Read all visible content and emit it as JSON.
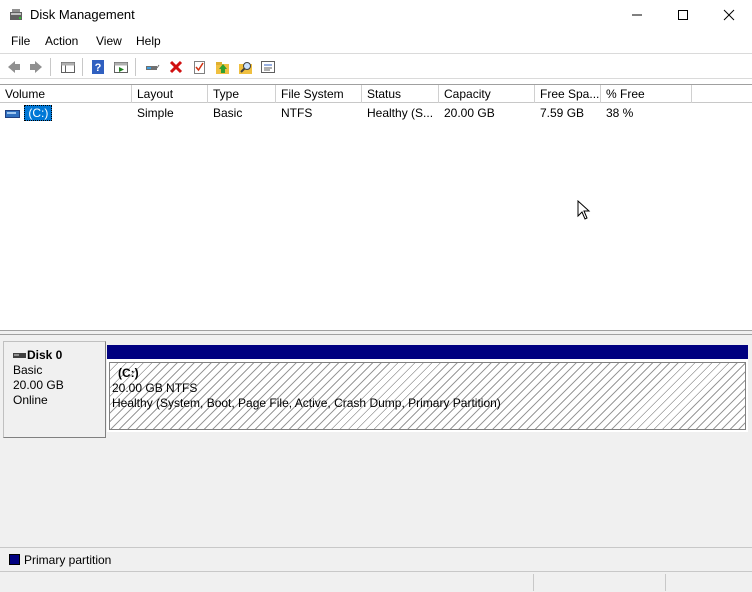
{
  "window": {
    "title": "Disk Management"
  },
  "menu": [
    "File",
    "Action",
    "View",
    "Help"
  ],
  "toolbar": {
    "icons": [
      "back-icon",
      "forward-icon",
      "console-tree-icon",
      "help-icon",
      "properties-view-icon",
      "connect-icon",
      "delete-icon",
      "check-icon",
      "folder-up-icon",
      "search-icon",
      "settings-icon"
    ]
  },
  "list": {
    "columns": [
      "Volume",
      "Layout",
      "Type",
      "File System",
      "Status",
      "Capacity",
      "Free Spa...",
      "% Free"
    ],
    "rows": [
      {
        "volume": "(C:)",
        "layout": "Simple",
        "type": "Basic",
        "file_system": "NTFS",
        "status": "Healthy (S...",
        "capacity": "20.00 GB",
        "free_space": "7.59 GB",
        "percent_free": "38 %"
      }
    ]
  },
  "disk": {
    "name": "Disk 0",
    "type": "Basic",
    "size": "20.00 GB",
    "state": "Online",
    "partition": {
      "name": "(C:)",
      "size_fs": "20.00 GB NTFS",
      "status": "Healthy (System, Boot, Page File, Active, Crash Dump, Primary Partition)"
    }
  },
  "legend": {
    "label": "Primary partition",
    "color": "#000080"
  },
  "colors": {
    "selection": "#0078d7",
    "primary_partition": "#000080"
  }
}
